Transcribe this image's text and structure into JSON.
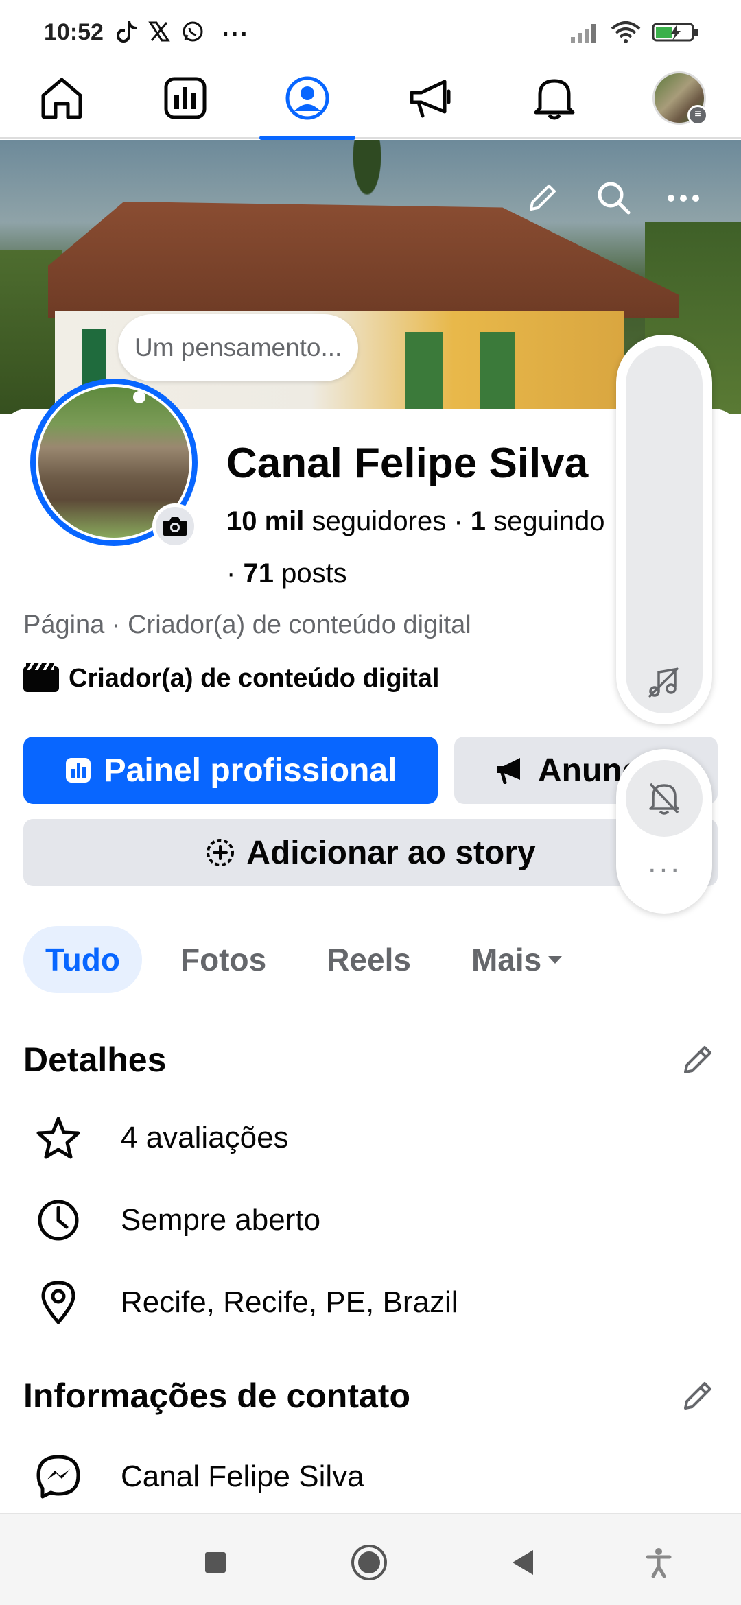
{
  "status_bar": {
    "time": "10:52",
    "notif_icons": [
      "tiktok-icon",
      "x-icon",
      "whatsapp-icon"
    ],
    "more": "···"
  },
  "nav": {
    "items": [
      "home",
      "dashboard",
      "profile",
      "ads",
      "notifications",
      "account"
    ]
  },
  "cover": {
    "actions": [
      "edit",
      "search",
      "more"
    ]
  },
  "thought_placeholder": "Um pensamento...",
  "profile": {
    "name": "Canal Felipe Silva",
    "followers_count": "10 mil",
    "followers_label": "seguidores",
    "sep": "·",
    "following_count": "1",
    "following_label": "seguindo",
    "posts_count": "71",
    "posts_label": "posts",
    "category": "Página · Criador(a) de conteúdo digital",
    "creator_label": "Criador(a) de conteúdo digital"
  },
  "buttons": {
    "dashboard": "Painel profissional",
    "advertise": "Anunciar",
    "add_story": "Adicionar ao story"
  },
  "tabs": [
    {
      "label": "Tudo",
      "active": true
    },
    {
      "label": "Fotos",
      "active": false
    },
    {
      "label": "Reels",
      "active": false
    },
    {
      "label": "Mais",
      "active": false
    }
  ],
  "details": {
    "title": "Detalhes",
    "rows": [
      {
        "icon": "star-icon",
        "text": "4 avaliações"
      },
      {
        "icon": "clock-icon",
        "text": "Sempre aberto"
      },
      {
        "icon": "location-pin-icon",
        "text": "Recife, Recife, PE, Brazil"
      }
    ]
  },
  "contact": {
    "title": "Informações de contato",
    "rows": [
      {
        "icon": "messenger-icon",
        "text": "Canal Felipe Silva"
      }
    ]
  },
  "float_panel": {
    "more": "···"
  },
  "colors": {
    "accent": "#0866ff",
    "secondary_button": "#e4e6eb",
    "muted_text": "#65676b",
    "active_tab_bg": "#e7f0fe"
  }
}
